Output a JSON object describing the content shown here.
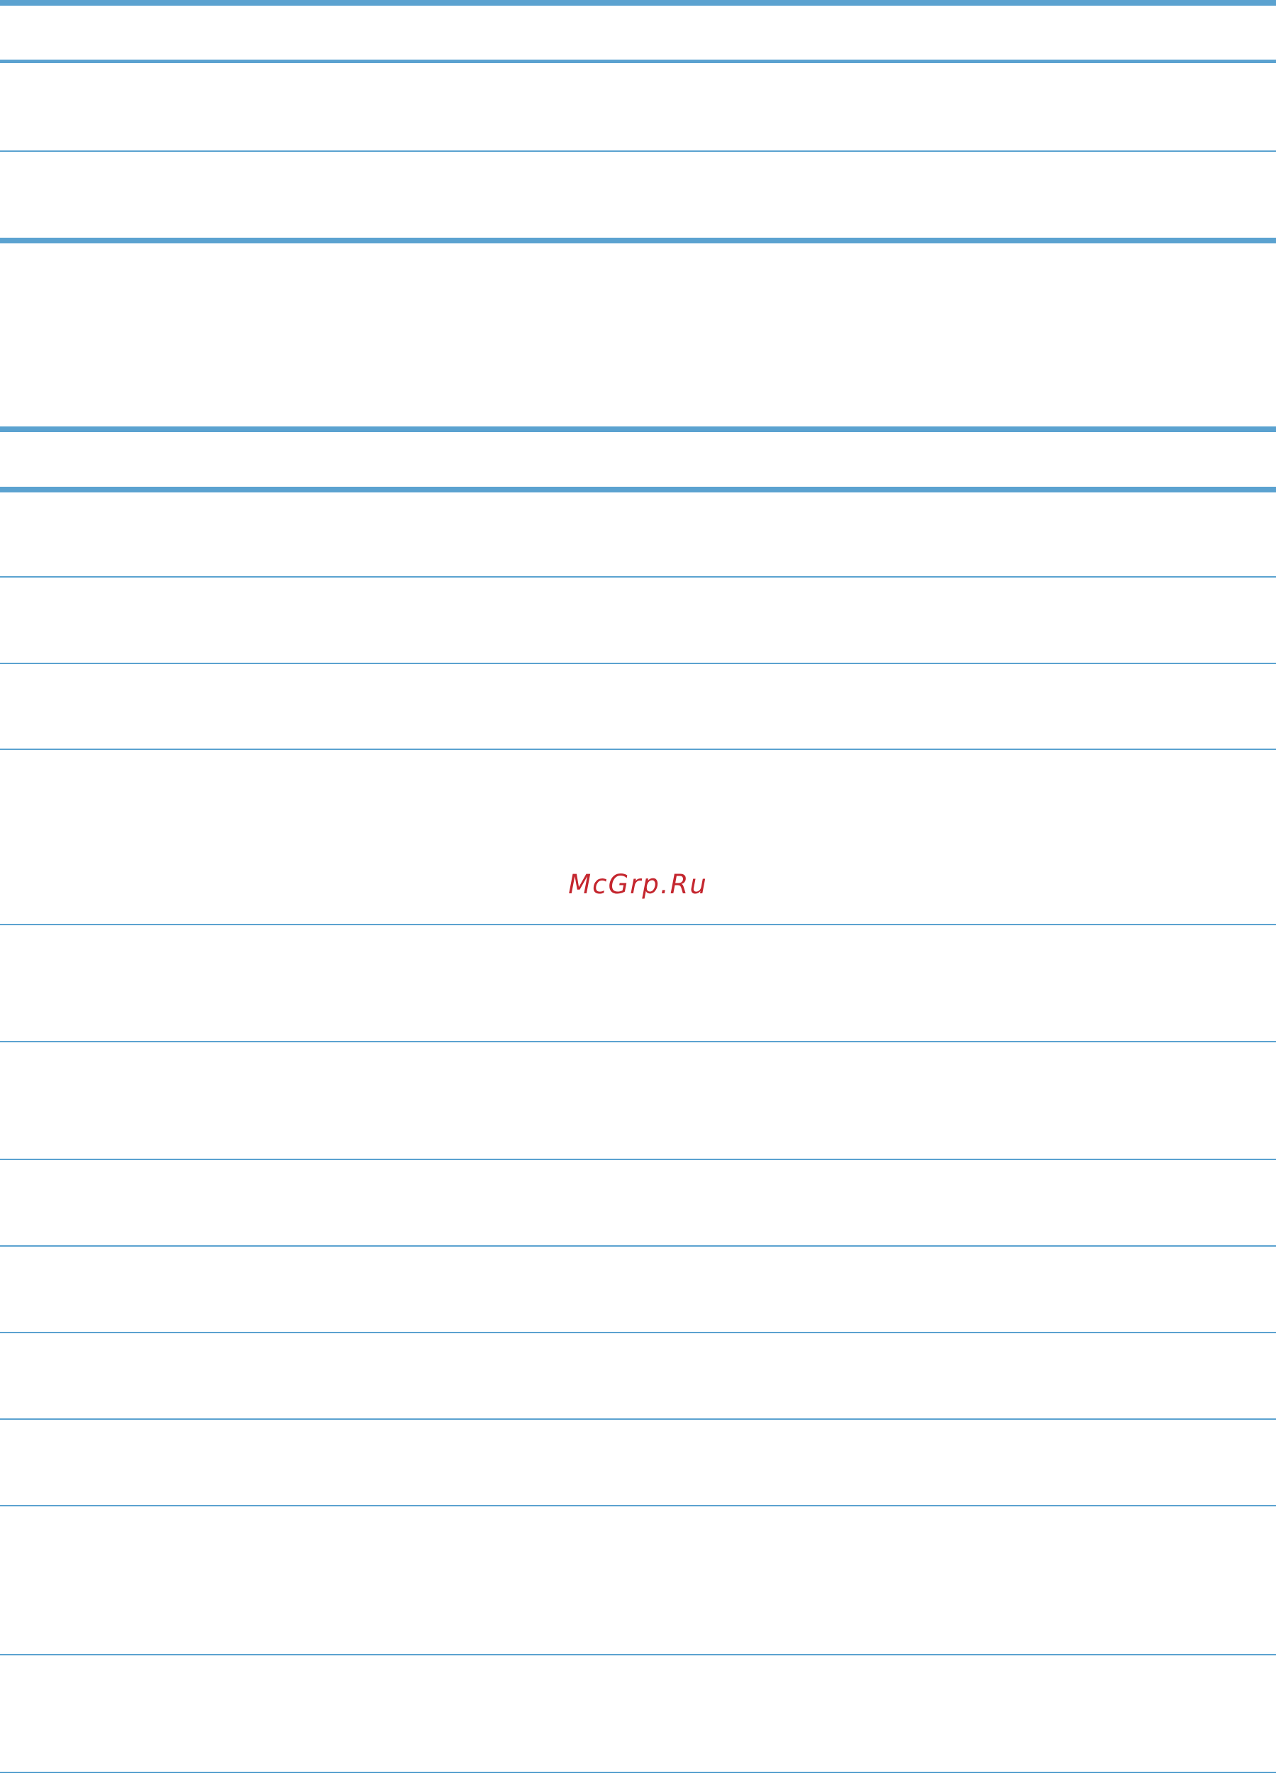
{
  "page": {
    "rule_color": "#5ba2d0",
    "watermark": {
      "text": "McGrp.Ru",
      "color": "#c4262e"
    }
  }
}
